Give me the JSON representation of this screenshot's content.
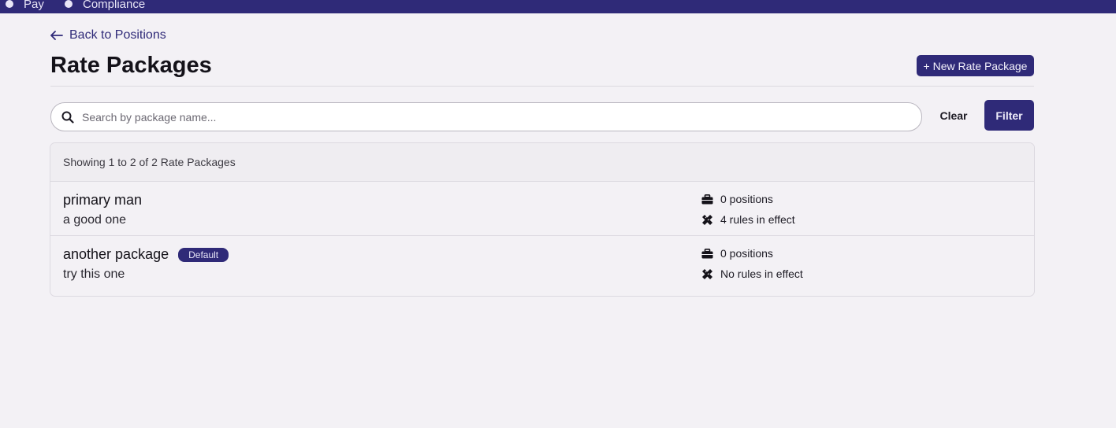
{
  "topnav": {
    "items": [
      {
        "label": "Pay",
        "icon": "dot-icon"
      },
      {
        "label": "Compliance",
        "icon": "dot-icon"
      }
    ],
    "background": "#2f2a78"
  },
  "back_link": {
    "label": "Back to Positions",
    "icon": "arrow-left-icon"
  },
  "page": {
    "title": "Rate Packages",
    "new_button_label": "+ New Rate Package"
  },
  "search": {
    "placeholder": "Search by package name...",
    "value": "",
    "icon": "search-icon",
    "clear_label": "Clear",
    "filter_label": "Filter"
  },
  "results": {
    "summary": "Showing 1 to 2 of 2 Rate Packages",
    "packages": [
      {
        "name": "primary man",
        "description": "a good one",
        "badge": "",
        "positions": "0 positions",
        "rules": "4 rules in effect"
      },
      {
        "name": "another package",
        "description": "try this one",
        "badge": "Default",
        "positions": "0 positions",
        "rules": "No rules in effect"
      }
    ]
  },
  "colors": {
    "accent": "#2f2a78",
    "background": "#f3f1f5",
    "border": "#dcd9e0"
  }
}
